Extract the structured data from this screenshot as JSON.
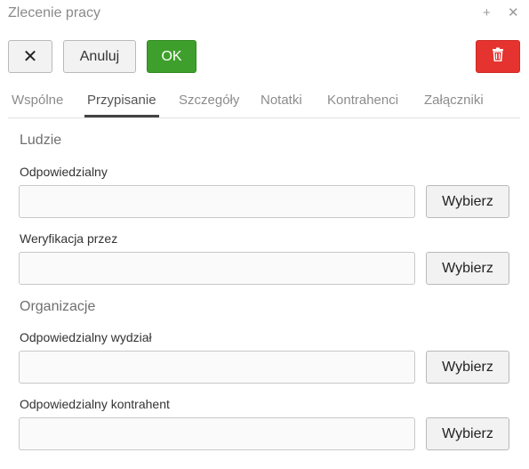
{
  "window": {
    "title": "Zlecenie pracy",
    "add_glyph": "+",
    "close_glyph": "✕"
  },
  "toolbar": {
    "close_glyph": "✕",
    "cancel_label": "Anuluj",
    "ok_label": "OK",
    "delete_icon": "trash-icon"
  },
  "tabs": [
    {
      "label": "Wspólne",
      "active": false
    },
    {
      "label": "Przypisanie",
      "active": true
    },
    {
      "label": "Szczegóły",
      "active": false
    },
    {
      "label": "Notatki",
      "active": false
    },
    {
      "label": "Kontrahenci",
      "active": false
    },
    {
      "label": "Załączniki",
      "active": false
    }
  ],
  "sections": {
    "people": "Ludzie",
    "organizations": "Organizacje"
  },
  "fields": [
    {
      "label": "Odpowiedzialny",
      "value": "",
      "button": "Wybierz"
    },
    {
      "label": "Weryfikacja przez",
      "value": "",
      "button": "Wybierz"
    },
    {
      "label": "Odpowiedzialny wydział",
      "value": "",
      "button": "Wybierz"
    },
    {
      "label": "Odpowiedzialny kontrahent",
      "value": "",
      "button": "Wybierz"
    }
  ],
  "colors": {
    "ok_green": "#3f9f2c",
    "delete_red": "#e5332f",
    "tab_active": "#444444"
  }
}
